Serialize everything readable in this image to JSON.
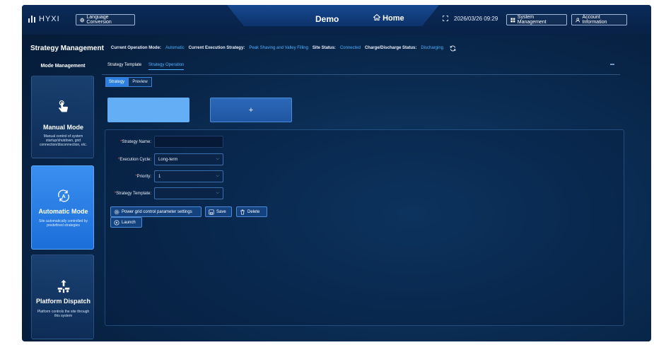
{
  "header": {
    "logo_text": "HYXI",
    "language_button": "Language Conversion",
    "center_title": "Demo",
    "home_label": "Home",
    "datetime": "2026/03/26 09:29",
    "system_management": "System Management",
    "account_information": "Account Information"
  },
  "titlebar": {
    "page_title": "Strategy Management",
    "mode_label": "Current Operation Mode:",
    "mode_value": "Automatic",
    "exec_label": "Current Execution Strategy:",
    "exec_value": "Peak Shaving and Valley Filling",
    "site_label": "Site Status:",
    "site_value": "Connected",
    "charge_label": "Charge/Discharge Status:",
    "charge_value": "Discharging"
  },
  "sidebar": {
    "title": "Mode Management",
    "modes": [
      {
        "name": "Manual Mode",
        "desc": "Manual control of system startup/shutdown, grid connection/disconnection, etc."
      },
      {
        "name": "Automatic Mode",
        "desc": "Site automatically controlled by predefined strategies"
      },
      {
        "name": "Platform Dispatch",
        "desc": "Platform controls the site through this system"
      }
    ]
  },
  "tabs": [
    "Strategy Template",
    "Strategy Operation"
  ],
  "segments": [
    "Strategy",
    "Preview"
  ],
  "add_card_symbol": "+",
  "form": {
    "name_label": "Strategy Name:",
    "name_value": "",
    "cycle_label": "Execution Cycle:",
    "cycle_value": "Long-term",
    "priority_label": "Priority:",
    "priority_value": "1",
    "template_label": "Strategy Template:",
    "template_value": "",
    "required_mark": "*"
  },
  "actions": {
    "grid_settings": "Power grid control parameter settings",
    "save": "Save",
    "delete": "Delete",
    "launch": "Launch"
  },
  "colors": {
    "accent": "#4fb1ff",
    "active_card": "#2f86ec",
    "strategy_card": "#63aef4",
    "required": "#ff5a5a"
  }
}
